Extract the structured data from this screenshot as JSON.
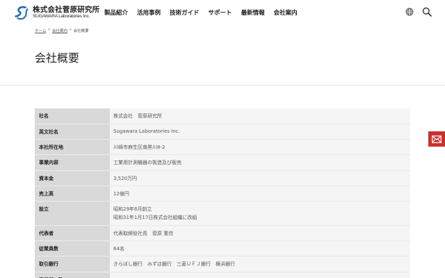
{
  "header": {
    "logo_jp": "株式会社菅原研究所",
    "logo_en": "SUGAWARA Laboratories Inc.",
    "nav": [
      "製品紹介",
      "活用事例",
      "技術ガイド",
      "サポート",
      "最新情報",
      "会社案内"
    ]
  },
  "breadcrumb": {
    "home": "ホーム",
    "section": "会社案内",
    "current": "会社概要",
    "separator": ">"
  },
  "page_title": "会社概要",
  "company_info": [
    {
      "label": "社名",
      "value": "株式会社　菅原研究所"
    },
    {
      "label": "英文社名",
      "value": "Sugawara Laboratories Inc."
    },
    {
      "label": "本社所在地",
      "value": "川崎市麻生区南黒川8-2"
    },
    {
      "label": "事業内容",
      "value": "工業用計測機器の製造及び販売"
    },
    {
      "label": "資本金",
      "value": "3,520万円"
    },
    {
      "label": "売上高",
      "value": "12億円"
    },
    {
      "label": "設立",
      "value": "昭和29年8月創立",
      "value2": "昭和31年1月17日株式会社組織に改組"
    },
    {
      "label": "代表者",
      "value": "代表取締役社長　菅原 重信"
    },
    {
      "label": "従業員数",
      "value": "64名"
    },
    {
      "label": "取引銀行",
      "value": "きらぼし銀行　みずほ銀行　三菱ＵＦＪ銀行　横浜銀行"
    },
    {
      "label": "事業所一覧",
      "value": ""
    }
  ],
  "colors": {
    "accent_blue": "#2a6fb5",
    "mail_red": "#c8322b",
    "label_bg": "#d9d9d9",
    "value_bg": "#f5f5f5"
  }
}
